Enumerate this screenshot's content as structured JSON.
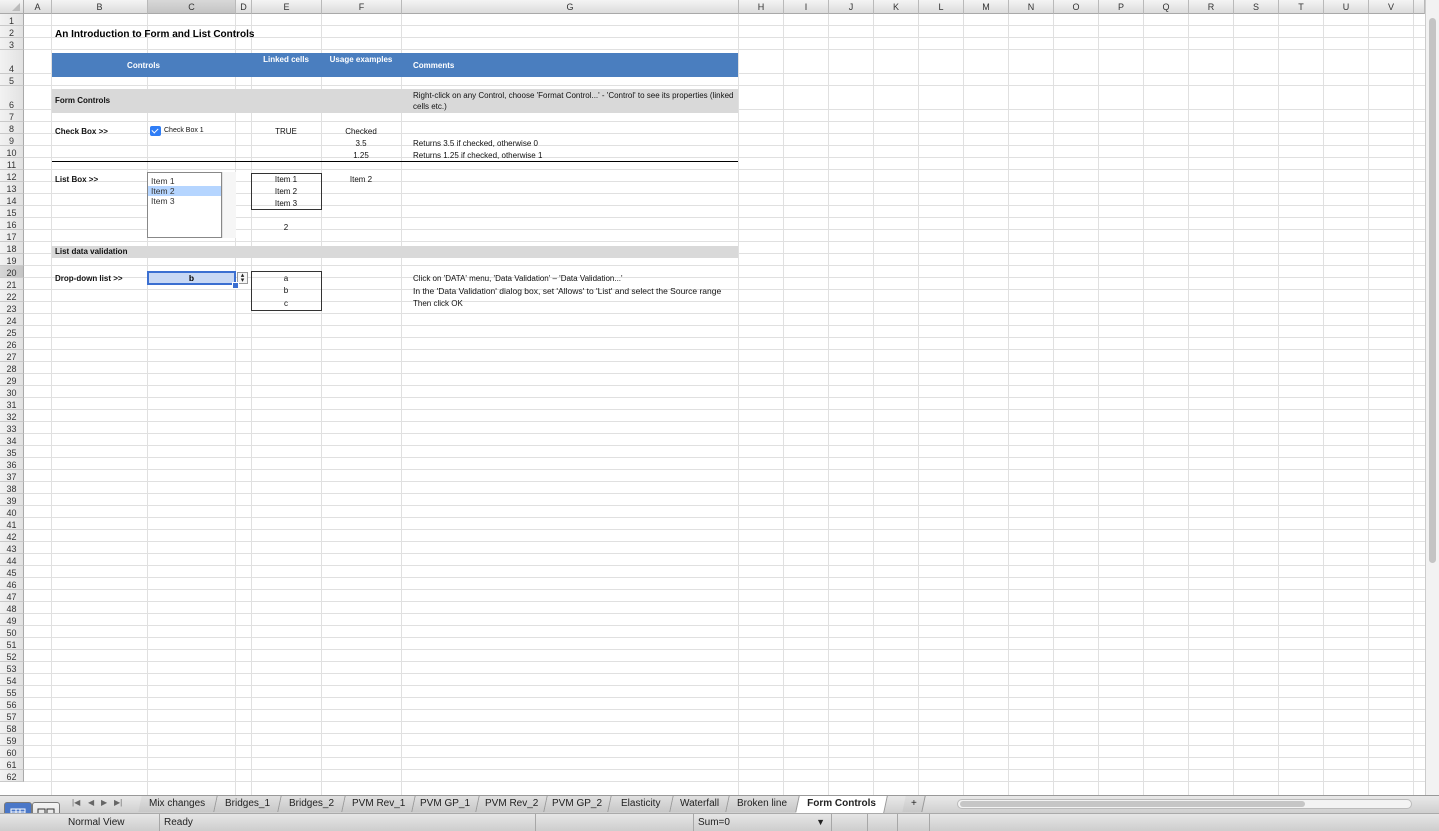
{
  "columns": [
    "A",
    "B",
    "C",
    "D",
    "E",
    "F",
    "G",
    "H",
    "I",
    "J",
    "K",
    "L",
    "M",
    "N",
    "O",
    "P",
    "Q",
    "R",
    "S",
    "T",
    "U",
    "V"
  ],
  "selected_column": "C",
  "selected_row": 20,
  "title": "An Introduction to Form and List Controls",
  "header": {
    "controls": "Controls",
    "linked_cells": "Linked cells",
    "usage_examples": "Usage examples",
    "comments": "Comments"
  },
  "form_controls": {
    "label": "Form Controls",
    "comment": "Right-click on any Control, choose 'Format Control...' - 'Control' to see its properties (linked cells etc.)"
  },
  "checkbox": {
    "label": "Check Box >>",
    "control_text": "Check Box 1",
    "checked": true,
    "linked": "TRUE",
    "usage": [
      "Checked",
      "3.5",
      "1.25"
    ],
    "comments": [
      "Returns 3.5 if checked, otherwise 0",
      "Returns 1.25 if checked, otherwise 1"
    ]
  },
  "listbox": {
    "label": "List Box >>",
    "items": [
      "Item 1",
      "Item 2",
      "Item 3"
    ],
    "selected_index": 1,
    "linked_items": [
      "Item 1",
      "Item 2",
      "Item 3"
    ],
    "linked_index": "2",
    "usage": "Item 2"
  },
  "list_validation": {
    "label": "List data validation"
  },
  "dropdown": {
    "label": "Drop-down list >>",
    "value": "b",
    "source": [
      "a",
      "b",
      "c"
    ],
    "comments": [
      "Click on 'DATA' menu, 'Data Validation' – 'Data Validation...'",
      "In the 'Data Validation' dialog box, set 'Allows' to 'List' and select the Source range",
      "Then click OK"
    ]
  },
  "tabs": [
    "Mix changes",
    "Bridges_1",
    "Bridges_2",
    "PVM Rev_1",
    "PVM GP_1",
    "PVM Rev_2",
    "PVM GP_2",
    "Elasticity",
    "Waterfall",
    "Broken line",
    "Form Controls"
  ],
  "active_tab": "Form Controls",
  "add_sheet": "+",
  "status": {
    "view": "Normal View",
    "state": "Ready",
    "sum": "Sum=0"
  },
  "colors": {
    "header_band": "#4a7ebf",
    "section_band": "#d9d9d9",
    "selection": "#3b6fd1"
  }
}
